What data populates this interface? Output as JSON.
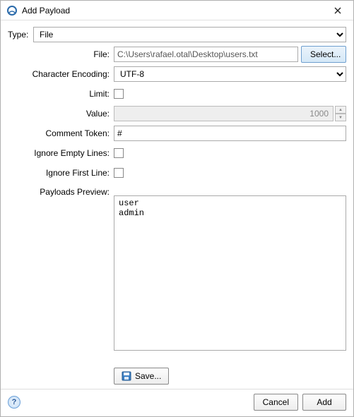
{
  "window": {
    "title": "Add Payload"
  },
  "form": {
    "type_label": "Type:",
    "type_value": "File",
    "file_label": "File:",
    "file_value": "C:\\Users\\rafael.otal\\Desktop\\users.txt",
    "select_button": "Select...",
    "encoding_label": "Character Encoding:",
    "encoding_value": "UTF-8",
    "limit_label": "Limit:",
    "limit_checked": false,
    "value_label": "Value:",
    "value_value": "1000",
    "comment_token_label": "Comment Token:",
    "comment_token_value": "#",
    "ignore_empty_label": "Ignore Empty Lines:",
    "ignore_empty_checked": false,
    "ignore_first_label": "Ignore First Line:",
    "ignore_first_checked": false,
    "preview_label": "Payloads Preview:",
    "preview_lines": [
      "user",
      "admin"
    ],
    "save_button": "Save..."
  },
  "footer": {
    "cancel": "Cancel",
    "add": "Add"
  }
}
